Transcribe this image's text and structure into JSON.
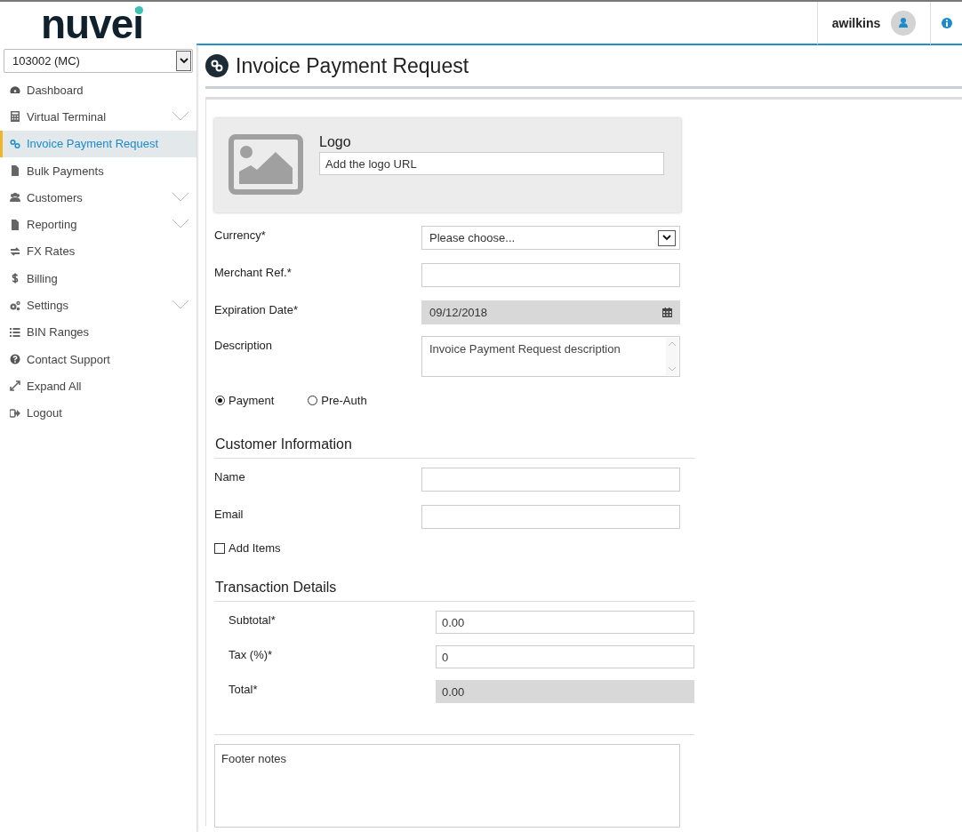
{
  "header": {
    "logo": "nuvei",
    "user": "awilkins"
  },
  "sidebar": {
    "account": "103002 (MC)",
    "items": [
      {
        "label": "Dashboard",
        "selected": false,
        "expandable": false
      },
      {
        "label": "Virtual Terminal",
        "selected": false,
        "expandable": true
      },
      {
        "label": "Invoice Payment Request",
        "selected": true,
        "expandable": false
      },
      {
        "label": "Bulk Payments",
        "selected": false,
        "expandable": false
      },
      {
        "label": "Customers",
        "selected": false,
        "expandable": true
      },
      {
        "label": "Reporting",
        "selected": false,
        "expandable": true
      },
      {
        "label": "FX Rates",
        "selected": false,
        "expandable": false
      },
      {
        "label": "Billing",
        "selected": false,
        "expandable": false
      },
      {
        "label": "Settings",
        "selected": false,
        "expandable": true
      },
      {
        "label": "BIN Ranges",
        "selected": false,
        "expandable": false
      },
      {
        "label": "Contact Support",
        "selected": false,
        "expandable": false
      },
      {
        "label": "Expand All",
        "selected": false,
        "expandable": false
      },
      {
        "label": "Logout",
        "selected": false,
        "expandable": false
      }
    ]
  },
  "page": {
    "title": "Invoice Payment Request"
  },
  "logo_card": {
    "label": "Logo",
    "placeholder": "Add the logo URL"
  },
  "fields": [
    {
      "kind": "select",
      "label": "Currency*",
      "value": "Please choose..."
    },
    {
      "kind": "text",
      "label": "Merchant Ref.*"
    },
    {
      "kind": "date",
      "label": "Expiration Date*",
      "value": "09/12/2018"
    },
    {
      "kind": "textarea",
      "label": "Description",
      "placeholder": "Invoice Payment Request description"
    }
  ],
  "payment_type": [
    {
      "label": "Payment",
      "selected": true
    },
    {
      "label": "Pre-Auth",
      "selected": false
    }
  ],
  "customer": {
    "heading": "Customer Information",
    "fields": [
      {
        "label": "Name"
      },
      {
        "label": "Email"
      }
    ],
    "add_items": {
      "label": "Add Items",
      "checked": false
    }
  },
  "transaction": {
    "heading": "Transaction Details",
    "fields": [
      {
        "label": "Subtotal*",
        "value": "0.00",
        "disabled": false
      },
      {
        "label": "Tax (%)*",
        "value": "0",
        "disabled": false
      },
      {
        "label": "Total*",
        "value": "0.00",
        "disabled": true
      }
    ]
  },
  "footer_notes": {
    "placeholder": "Footer notes"
  }
}
